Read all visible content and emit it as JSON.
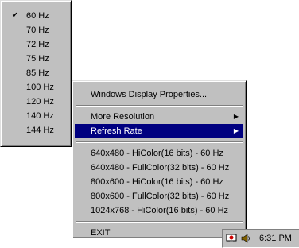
{
  "refresh_submenu": {
    "items": [
      {
        "label": "60 Hz",
        "checked": true
      },
      {
        "label": "70 Hz",
        "checked": false
      },
      {
        "label": "72 Hz",
        "checked": false
      },
      {
        "label": "75 Hz",
        "checked": false
      },
      {
        "label": "85 Hz",
        "checked": false
      },
      {
        "label": "100 Hz",
        "checked": false
      },
      {
        "label": "120 Hz",
        "checked": false
      },
      {
        "label": "140 Hz",
        "checked": false
      },
      {
        "label": "144 Hz",
        "checked": false
      }
    ],
    "check_glyph": "✔"
  },
  "main_menu": {
    "display_properties": "Windows Display Properties...",
    "more_resolution": "More Resolution",
    "refresh_rate": "Refresh Rate",
    "arrow_glyph": "▶",
    "resolutions": [
      "640x480 - HiColor(16 bits) - 60 Hz",
      "640x480 - FullColor(32 bits) - 60 Hz",
      "800x600 - HiColor(16 bits) - 60 Hz",
      "800x600 - FullColor(32 bits) - 60 Hz",
      "1024x768 - HiColor(16 bits) - 60 Hz"
    ],
    "exit": "EXIT"
  },
  "taskbar": {
    "clock": "6:31 PM",
    "tray_icons": [
      "display-settings-icon",
      "volume-icon"
    ]
  },
  "colors": {
    "menu_face": "#c0c0c0",
    "highlight": "#000080",
    "highlight_text": "#ffffff"
  }
}
